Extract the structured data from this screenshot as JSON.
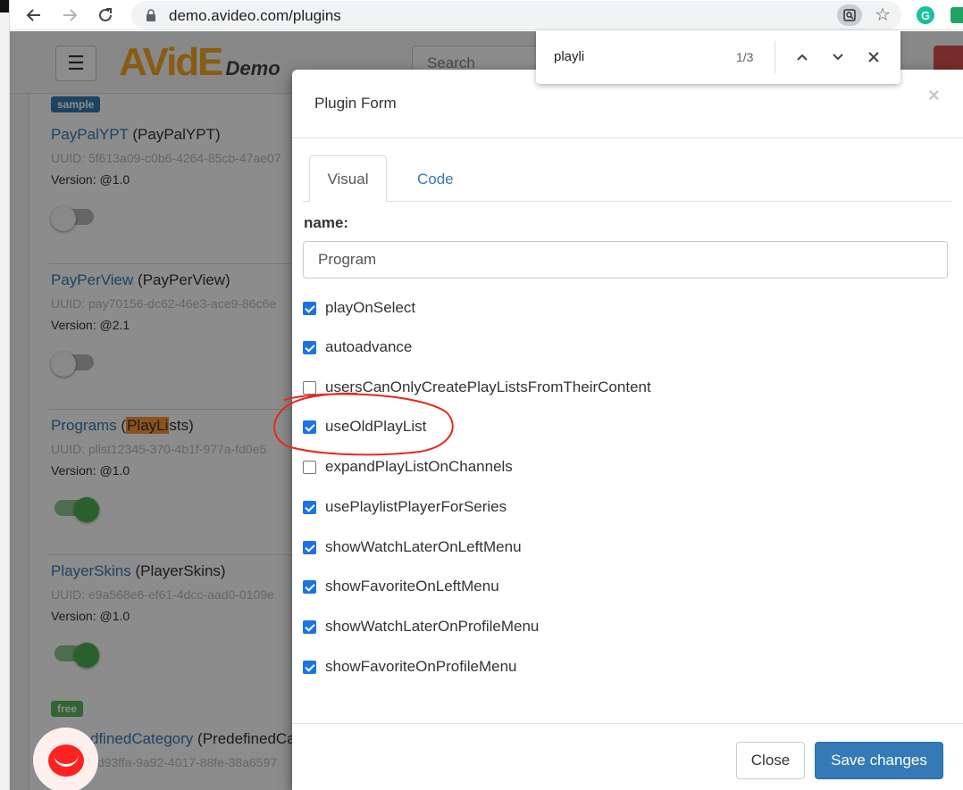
{
  "browser": {
    "url": "demo.avideo.com/plugins",
    "extension_letter": "G"
  },
  "find_bar": {
    "query": "playli",
    "count": "1/3"
  },
  "page": {
    "logo_text": "AVidE",
    "logo_sub": "Demo",
    "search_placeholder": "Search",
    "badges": {
      "sample": "sample",
      "free": "free"
    },
    "plugins": [
      {
        "name": "PayPalYPT",
        "paren": "(PayPalYPT)",
        "uuid": "UUID: 5f613a09-c0b6-4264-85cb-47ae07",
        "version": "Version: @1.0",
        "enabled": false
      },
      {
        "name": "PayPerView",
        "paren": "(PayPerView)",
        "uuid": "UUID: pay70156-dc62-46e3-ace9-86c6e",
        "version": "Version: @2.1",
        "enabled": false
      },
      {
        "name": "Programs",
        "paren_open": "(",
        "paren_highlight": "PlayLi",
        "paren_rest": "sts)",
        "uuid": "UUID: plist12345-370-4b1f-977a-fd0e5",
        "version": "Version: @1.0",
        "enabled": true
      },
      {
        "name": "PlayerSkins",
        "paren": "(PlayerSkins)",
        "uuid": "UUID: e9a568e6-ef61-4dcc-aad0-0109e",
        "version": "Version: @1.0",
        "enabled": true
      },
      {
        "name": "dfinedCategory",
        "paren": "(PredefinedCa",
        "uuid": "0d93ffa-9a92-4017-88fe-38a6597"
      }
    ]
  },
  "modal": {
    "title": "Plugin Form",
    "close_x": "×",
    "tabs": [
      "Visual",
      "Code"
    ],
    "name_label": "name:",
    "name_value": "Program",
    "options": [
      {
        "label": "playOnSelect",
        "checked": true
      },
      {
        "label": "autoadvance",
        "checked": true
      },
      {
        "label": "usersCanOnlyCreatePlayListsFromTheirContent",
        "checked": false
      },
      {
        "label": "useOldPlayList",
        "checked": true
      },
      {
        "label": "expandPlayListOnChannels",
        "checked": false
      },
      {
        "label": "usePlaylistPlayerForSeries",
        "checked": true
      },
      {
        "label": "showWatchLaterOnLeftMenu",
        "checked": true
      },
      {
        "label": "showFavoriteOnLeftMenu",
        "checked": true
      },
      {
        "label": "showWatchLaterOnProfileMenu",
        "checked": true
      },
      {
        "label": "showFavoriteOnProfileMenu",
        "checked": true
      }
    ],
    "close_button": "Close",
    "save_button": "Save changes"
  },
  "colors": {
    "primary": "#337ab7",
    "checkbox": "#1a73e8",
    "annotation": "#e8261c",
    "toggle_on": "#4caf50"
  }
}
